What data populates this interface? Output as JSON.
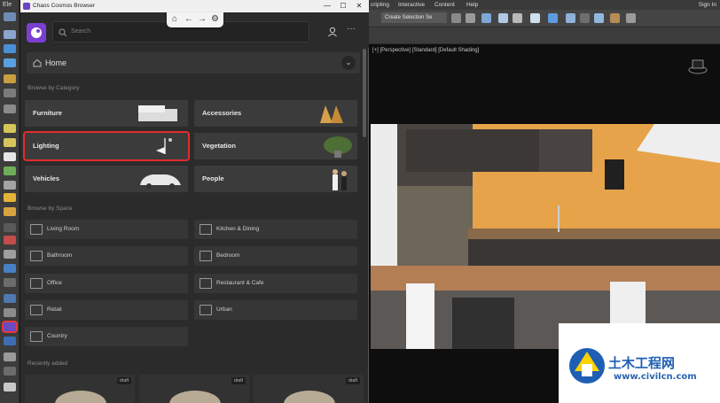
{
  "cosmos_window": {
    "title": "Chaos Cosmos Browser",
    "controls": {
      "minimize": "—",
      "maximize": "☐",
      "close": "✕"
    },
    "nav": {
      "home": "⌂",
      "back": "←",
      "forward": "→",
      "settings": "⚙"
    },
    "search_placeholder": "Search",
    "more": "···",
    "home_label": "Home",
    "home_chevron": "⌄",
    "browse_by_category": "Browse by Category",
    "categories": [
      {
        "label": "Furniture",
        "selected": false
      },
      {
        "label": "Accessories",
        "selected": false
      },
      {
        "label": "Lighting",
        "selected": true
      },
      {
        "label": "Vegetation",
        "selected": false
      },
      {
        "label": "Vehicles",
        "selected": false
      },
      {
        "label": "People",
        "selected": false
      }
    ],
    "browse_by_space": "Browse by Space",
    "spaces": [
      {
        "label": "Living Room"
      },
      {
        "label": "Kitchen & Dining"
      },
      {
        "label": "Bathroom"
      },
      {
        "label": "Bedroom"
      },
      {
        "label": "Office"
      },
      {
        "label": "Restaurant & Cafe"
      },
      {
        "label": "Retail"
      },
      {
        "label": "Urban"
      },
      {
        "label": "Country"
      }
    ],
    "recently_added": "Recently added",
    "recent_items": [
      {
        "badge": "draft"
      },
      {
        "badge": "draft"
      },
      {
        "badge": "draft"
      }
    ]
  },
  "max": {
    "menu": [
      "cripting",
      "Interactive",
      "Content",
      "Help"
    ],
    "sign_in": "Sign In",
    "selection_set": "Create Selection Se",
    "viewport_label": "[+] [Perspective] [Standard] [Default Shading]",
    "left_top": "Ele"
  },
  "watermark": {
    "text": "土木工程网",
    "url": "www.civilcn.com"
  },
  "colors": {
    "accent_purple": "#7a3fd1",
    "selection_red": "#e32c2c",
    "watermark_blue": "#1e5fb3"
  }
}
